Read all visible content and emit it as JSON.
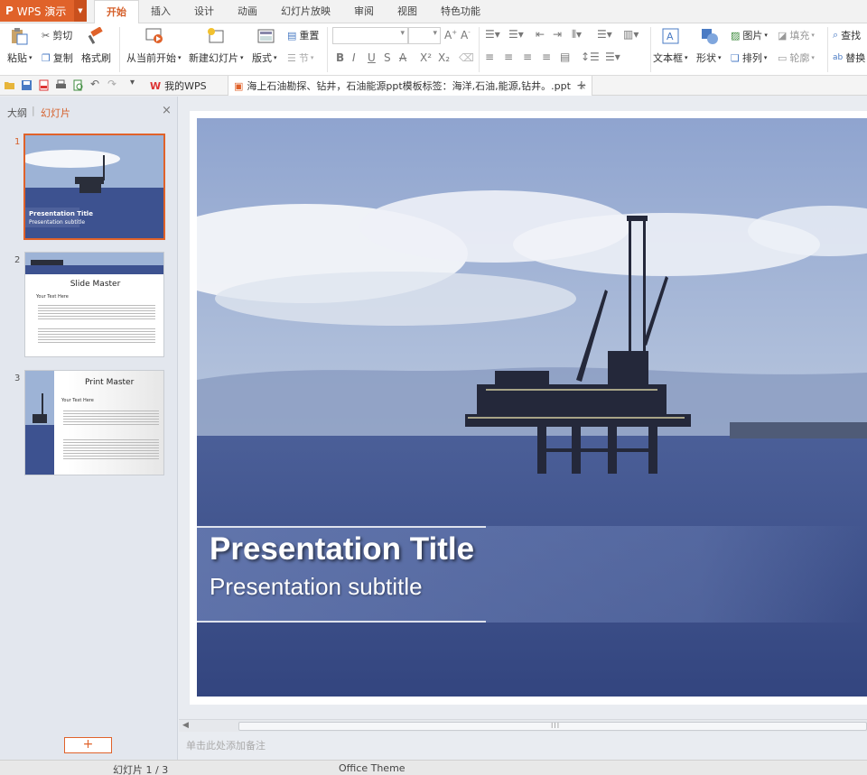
{
  "app": {
    "name": "WPS 演示",
    "logo": "P"
  },
  "menu_tabs": [
    "开始",
    "插入",
    "设计",
    "动画",
    "幻灯片放映",
    "审阅",
    "视图",
    "特色功能"
  ],
  "ribbon": {
    "cut": "剪切",
    "paste": "粘贴",
    "copy": "复制",
    "format_painter": "格式刷",
    "from_current": "从当前开始",
    "new_slide": "新建幻灯片",
    "layout": "版式",
    "reset": "重置",
    "section": "节",
    "textbox": "文本框",
    "shape": "形状",
    "picture": "图片",
    "arrange": "排列",
    "fill": "填充",
    "outline": "轮廓",
    "find": "查找",
    "replace": "替换"
  },
  "doc_tabs": {
    "home": "我的WPS",
    "file": "海上石油勘探、钻井，石油能源ppt模板标签：海洋,石油,能源,钻井。.ppt",
    "close": "×",
    "new": "+"
  },
  "left_panel": {
    "outline_tab": "大纲",
    "divider": "|",
    "slides_tab": "幻灯片",
    "close": "×",
    "add_button": "+"
  },
  "thumbnails": [
    {
      "num": "1",
      "title": "Presentation Title",
      "subtitle": "Presentation subtitle"
    },
    {
      "num": "2",
      "title": "Slide Master",
      "bullet": "Your Text Here"
    },
    {
      "num": "3",
      "title": "Print Master",
      "bullet": "Your Text Here"
    }
  ],
  "slide": {
    "title": "Presentation Title",
    "subtitle": "Presentation subtitle"
  },
  "scroll_grip": "III",
  "notes_placeholder": "单击此处添加备注",
  "status": {
    "slide_counter": "幻灯片 1 / 3",
    "theme": "Office Theme"
  },
  "colors": {
    "accent": "#e0622a",
    "sea": "#3c4f8a",
    "sky": "#8fa6c9"
  }
}
